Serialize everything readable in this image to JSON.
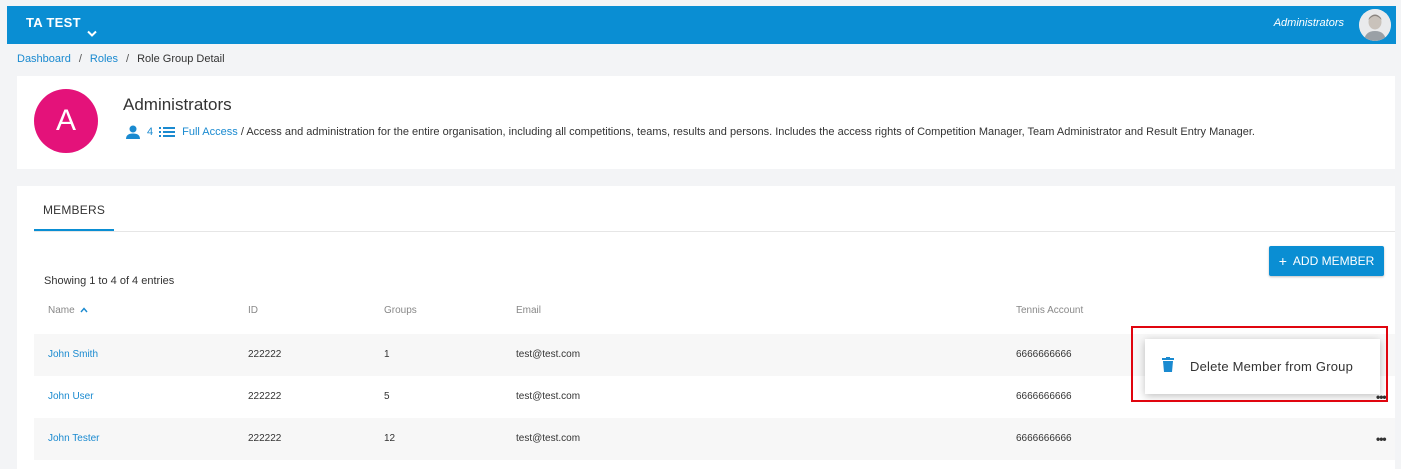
{
  "topbar": {
    "org_name": "TA TEST",
    "user_label": "Administrators"
  },
  "breadcrumb": {
    "items": [
      "Dashboard",
      "Roles",
      "Role Group Detail"
    ],
    "separator": "/"
  },
  "group": {
    "avatar_letter": "A",
    "title": "Administrators",
    "member_count": "4",
    "access_label": "Full Access",
    "description": " / Access and administration for the entire organisation, including all competitions, teams, results and persons. Includes the access rights of Competition Manager, Team Administrator and Result Entry Manager."
  },
  "members": {
    "tab_label": "MEMBERS",
    "add_button_label": "ADD MEMBER",
    "showing_text": "Showing 1 to 4 of 4 entries",
    "columns": [
      "Name",
      "ID",
      "Groups",
      "Email",
      "Tennis Account"
    ],
    "rows": [
      {
        "name": "John Smith",
        "id": "222222",
        "groups": "1",
        "email": "test@test.com",
        "tennis": "6666666666"
      },
      {
        "name": "John User",
        "id": "222222",
        "groups": "5",
        "email": "test@test.com",
        "tennis": "6666666666"
      },
      {
        "name": "John Tester",
        "id": "222222",
        "groups": "12",
        "email": "test@test.com",
        "tennis": "6666666666"
      }
    ],
    "row_menu_glyph": "•••"
  },
  "context_menu": {
    "delete_label": "Delete Member from Group"
  },
  "colors": {
    "primary": "#0a8ed3",
    "avatar_bg": "#e4127a",
    "highlight": "#e0050f"
  }
}
